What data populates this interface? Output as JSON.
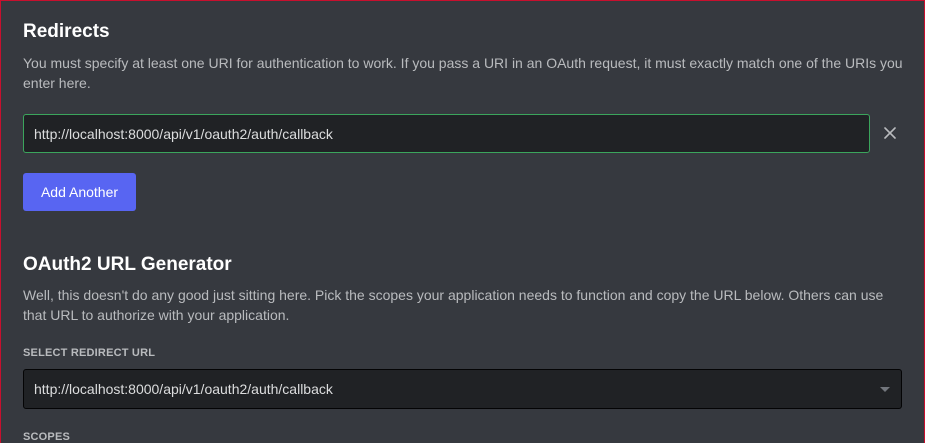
{
  "redirects": {
    "title": "Redirects",
    "description": "You must specify at least one URI for authentication to work. If you pass a URI in an OAuth request, it must exactly match one of the URIs you enter here.",
    "uri_value": "http://localhost:8000/api/v1/oauth2/auth/callback",
    "add_button_label": "Add Another",
    "remove_icon": "close-icon"
  },
  "generator": {
    "title": "OAuth2 URL Generator",
    "description": "Well, this doesn't do any good just sitting here. Pick the scopes your application needs to function and copy the URL below. Others can use that URL to authorize with your application.",
    "select_label": "SELECT REDIRECT URL",
    "selected_url": "http://localhost:8000/api/v1/oauth2/auth/callback",
    "dropdown_icon": "chevron-down-icon",
    "scopes_label": "SCOPES"
  },
  "colors": {
    "background": "#36393f",
    "input_background": "#202225",
    "valid_border": "#3ba55c",
    "brand_button": "#5865f2",
    "window_border": "#c8102e"
  }
}
